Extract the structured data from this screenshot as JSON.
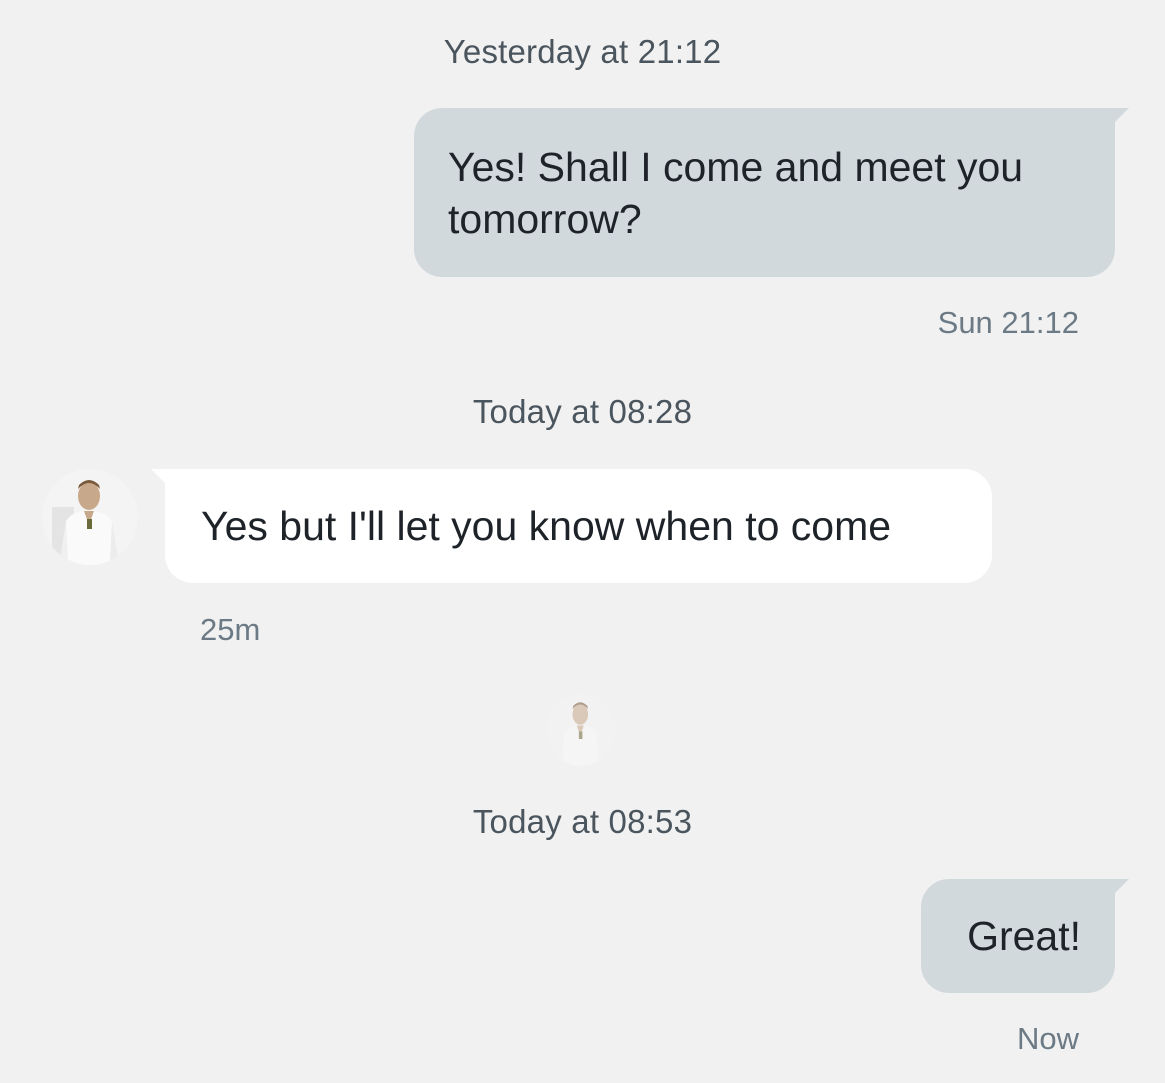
{
  "conversation": {
    "messages": [
      {
        "separator": "Yesterday at 21:12",
        "direction": "out",
        "text_line1": "Yes! Shall I come and meet you",
        "text_line2": "tomorrow?",
        "time": "Sun 21:12"
      },
      {
        "separator": "Today at 08:28",
        "direction": "in",
        "text": "Yes but I'll let you know when to come",
        "time": "25m",
        "avatar_icon": "contact-avatar-icon"
      },
      {
        "separator": "Today at 08:53",
        "direction": "out",
        "text": "Great!",
        "time": "Now"
      }
    ],
    "seen_indicator_icon": "seen-avatar-icon"
  },
  "colors": {
    "background": "#f1f1f1",
    "outgoing_bubble": "#d2d9dc",
    "incoming_bubble": "#ffffff",
    "separator_text": "#4a555e",
    "meta_text": "#6c7a85"
  }
}
